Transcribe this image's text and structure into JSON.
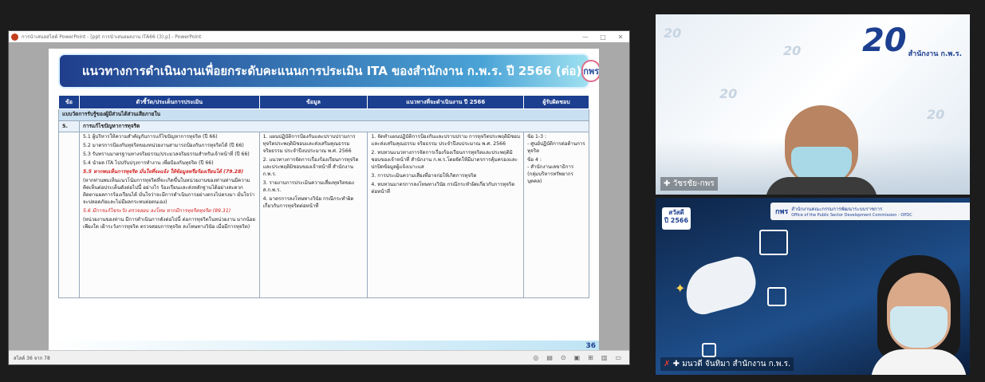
{
  "ppt": {
    "window_title": "การนำเสนอสไลด์ PowerPoint - [ppt การนำเสนอผลงาน ITA66 (3).p] - PowerPoint",
    "minimize": "—",
    "maximize": "□",
    "close": "✕",
    "status_left": "สไลด์ 36 จาก 78",
    "slide_number": "36"
  },
  "slide": {
    "title": "แนวทางการดำเนินงานเพื่อยกระดับคะแนนการประเมิน ITA ของสำนักงาน ก.พ.ร. ปี 2566 (ต่อ)",
    "logo_text": "กพร",
    "table": {
      "headers": [
        "ข้อ",
        "ตัวชี้วัด/ประเด็นการประเมิน",
        "ข้อมูล",
        "แนวทางที่จะดำเนินงาน ปี 2566",
        "ผู้รับผิดชอบ"
      ],
      "section_row": "แบบวัดการรับรู้ของผู้มีส่วนได้ส่วนเสียภายใน",
      "sub_no": "5.",
      "sub_title": "การแก้ไขปัญหาการทุจริต",
      "col2": [
        "5.1 ผู้บริหารให้ความสำคัญกับการแก้ไขปัญหาการทุจริต (ปี 66)",
        "5.2 มาตรการป้องกันทุจริตของหน่วยงานสามารถป้องกันการทุจริตได้ (ปี 66)",
        "5.3 รับทราบมาตรฐานทางจริยธรรม/ประมวลจริยธรรมสำหรับเจ้าหน้าที่ (ปี 66)",
        "5.4 นำผล ITA ไปปรับปรุงการทำงาน เพื่อป้องกันทุจริต (ปี 66)"
      ],
      "col2_red1": "5.5 หากพบเห็นการทุจริต มั่นใจที่จะแจ้ง ให้ข้อมูลหรือร้องเรียนได้ (79.28)",
      "col2_note1": "(หากท่านพบเห็นแนวโน้มการทุจริตที่จะเกิดขึ้นในหน่วยงานของท่านท่านมีความคิดเห็นต่อประเด็นดังต่อไปนี้ อย่างไร ร้องเรียนและส่งหลักฐานได้อย่างสะดวก ติดตามผลการร้องเรียนได้ มั่นใจว่าจะมีการดำเนินการอย่างตรงไปตรงมา มั่นใจว่าจะปลอดภัยและไม่มีผลกระทบต่อตนเอง)",
      "col2_red2": "5.6 มีการแก้ไขระวัง ตรวจสอบ ลงโทษ หากมีการทุจริตทุจริต (89.31)",
      "col2_note2": "(หน่วยงานของท่าน มีการดำเนินการดังต่อไปนี้ ต่อการทุจริตในหน่วยงาน มากน้อยเพียงใด เฝ้าระวังการทุจริต ตรวจสอบการทุจริต ลงโทษทางวินัย เมื่อมีการทุจริต)",
      "col3": [
        "1. แผนปฏิบัติการป้องกันและปราบปรามการทุจริตประพฤติมิชอบและส่งเสริมคุณธรรม จริยธรรม ประจำปีงบประมาณ พ.ศ. 2566",
        "2. แนวทางการจัดการเรื่องร้องเรียนการทุจริตและประพฤติมิชอบของเจ้าหน้าที่ สำนักงาน ก.พ.ร.",
        "3. รายงานการประเมินความเสี่ยงทุจริตของ ส.ก.พ.ร.",
        "4. มาตรการลงโทษทางวินัย กรณีกระทำผิดเกี่ยวกับการทุจริตต่อหน้าที่"
      ],
      "col4": [
        "1. จัดทำแผนปฏิบัติการป้องกันและปราบปราม การทุจริตประพฤติมิชอบและส่งเสริมคุณธรรม จริยธรรม ประจำปีงบประมาณ พ.ศ. 2566",
        "2. ทบทวนแนวทางการจัดการเรื่องร้องเรียนการทุจริตและประพฤติมิชอบของเจ้าหน้าที่ สำนักงาน ก.พ.ร.โดยจัดให้มีมาตรการคุ้มครองและปกปิดข้อมูลผู้แจ้งเบาะแส",
        "3. การประเมินความเสี่ยงที่อาจก่อให้เกิดการทุจริต",
        "4. ทบทวนมาตรการลงโทษทางวินัย กรณีกระทำผิดเกี่ยวกับการทุจริตต่อหน้าที่"
      ],
      "col5": [
        "ข้อ 1-3 :",
        "- ศูนย์ปฏิบัติการต่อต้านการทุจริต",
        "ข้อ 4 :",
        "- สำนักงานเลขาธิการ (กลุ่มบริหารทรัพยากรบุคคล)"
      ]
    }
  },
  "video1": {
    "logo_num": "20",
    "logo_sub": "สำนักงาน ก.พ.ร.",
    "watermark": "20",
    "name": "วัชรชัย-กพร"
  },
  "video2": {
    "banner_logo": "กพร",
    "banner_text": "สำนักงานคณะกรรมการพัฒนาระบบราชการ",
    "banner_sub": "Office of the Public Sector Development Commission - OPDC",
    "greeting": "สวัสดี",
    "greeting_year": "ปี 2566",
    "name": "มนวดี จันทิมา สำนักงาน ก.พ.ร."
  }
}
